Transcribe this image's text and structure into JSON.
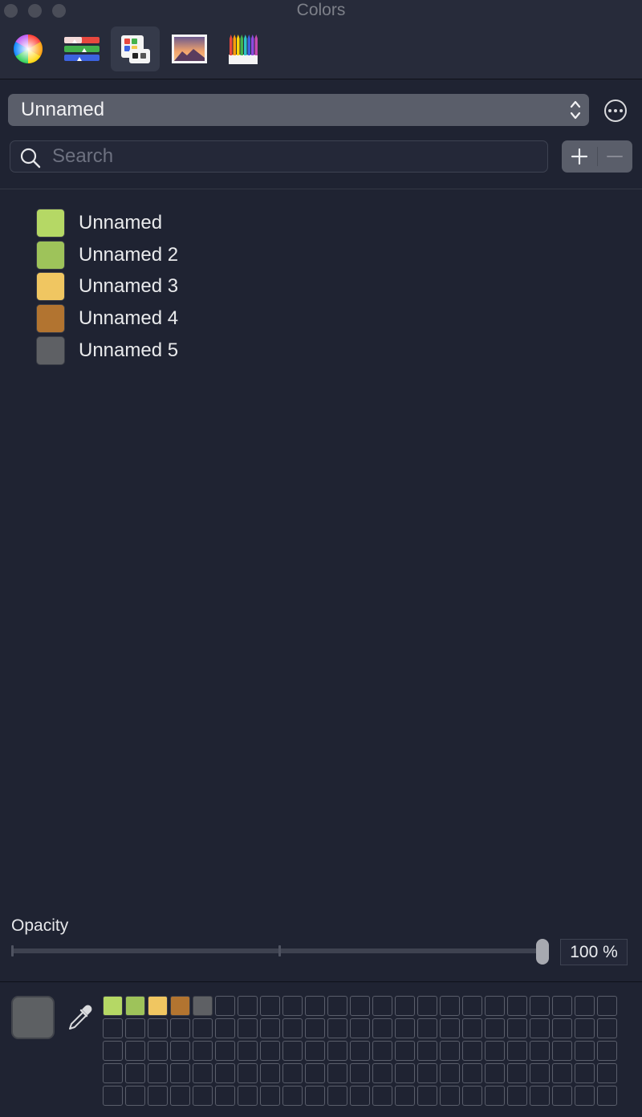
{
  "window": {
    "title": "Colors"
  },
  "toolbar": {
    "tabs": [
      {
        "name": "color-wheel",
        "icon": "color-wheel-icon"
      },
      {
        "name": "sliders",
        "icon": "color-sliders-icon"
      },
      {
        "name": "palettes",
        "icon": "color-palettes-icon",
        "active": true
      },
      {
        "name": "image",
        "icon": "image-palettes-icon"
      },
      {
        "name": "pencils",
        "icon": "pencils-icon"
      }
    ]
  },
  "palette_select": {
    "value": "Unnamed"
  },
  "search": {
    "placeholder": "Search",
    "value": ""
  },
  "colors": [
    {
      "name": "Unnamed",
      "color": "#b5d865"
    },
    {
      "name": "Unnamed 2",
      "color": "#9ec35a"
    },
    {
      "name": "Unnamed 3",
      "color": "#f0c661"
    },
    {
      "name": "Unnamed 4",
      "color": "#b27430"
    },
    {
      "name": "Unnamed 5",
      "color": "#5e6064"
    }
  ],
  "opacity": {
    "label": "Opacity",
    "value_text": "100 %",
    "value": 1.0
  },
  "current_color": "#5d6063",
  "swatch_grid": {
    "filled": [
      "#b5d865",
      "#9ec35a",
      "#f0c661",
      "#b27430",
      "#5e6064"
    ],
    "empty_cells_count_hint": 115
  }
}
